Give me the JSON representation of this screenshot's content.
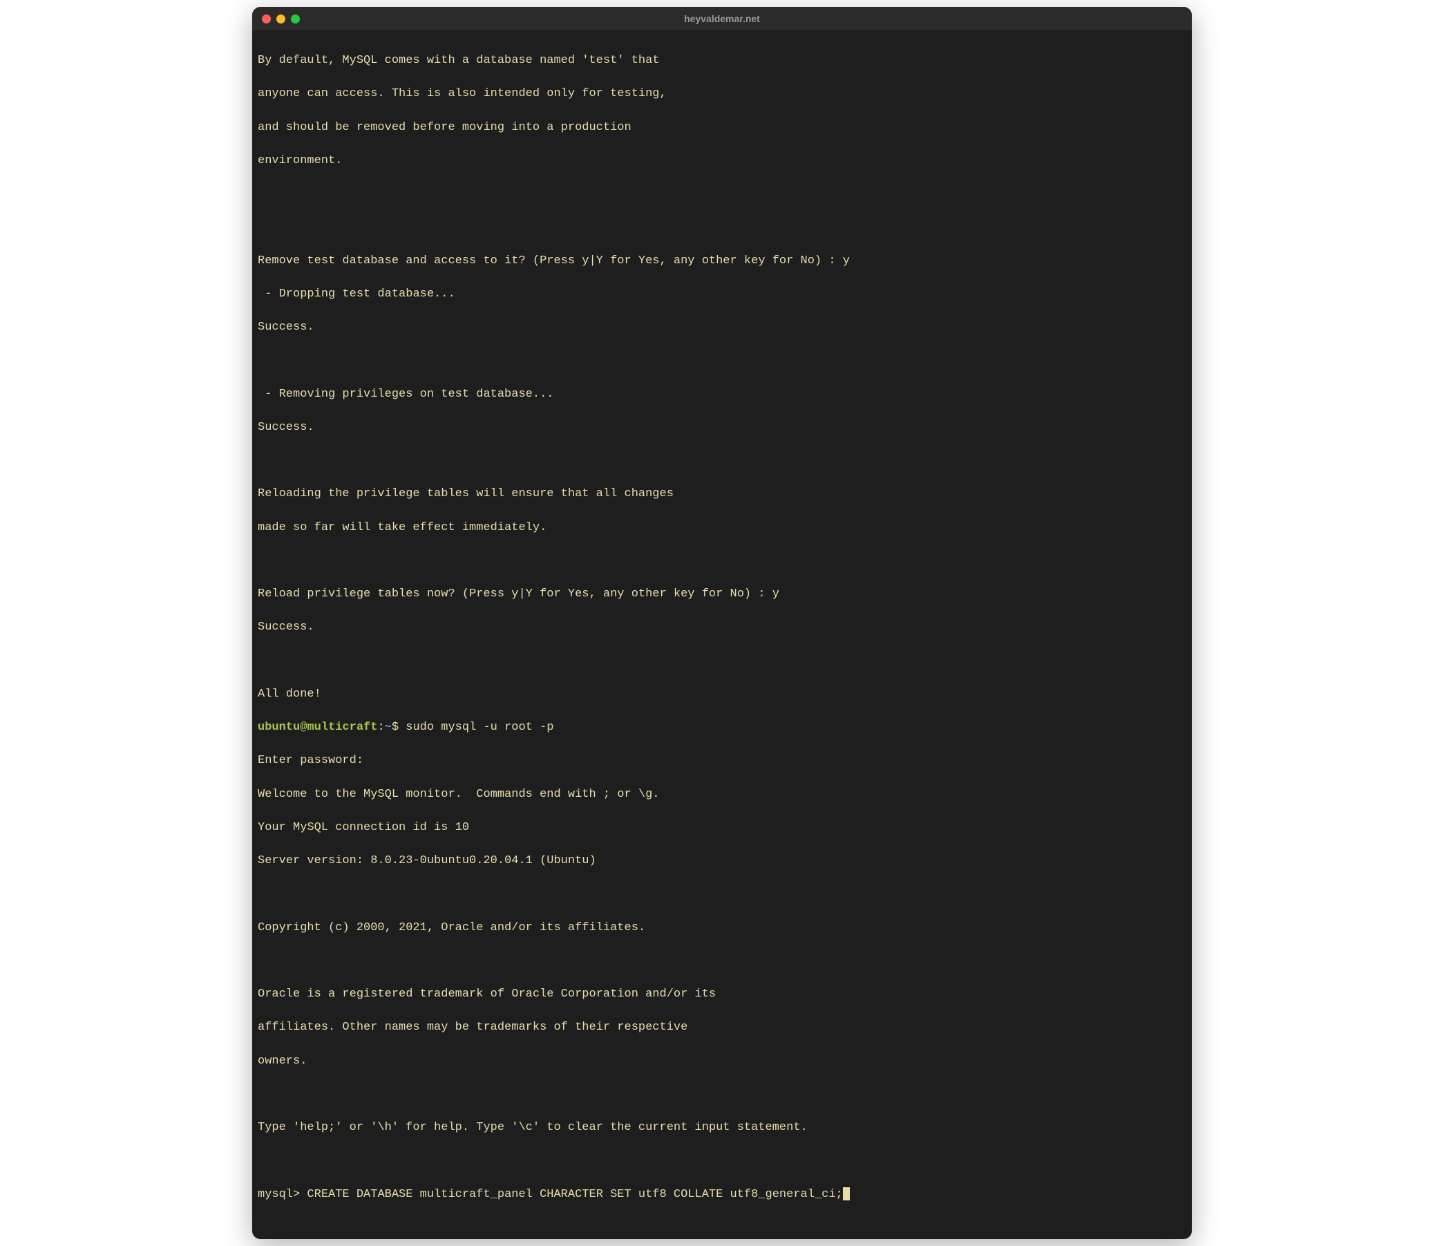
{
  "window": {
    "title": "heyvaldemar.net"
  },
  "prompt": {
    "user_host": "ubuntu@multicraft",
    "colon": ":",
    "path": "~",
    "symbol": "$ "
  },
  "mysql_prompt": "mysql> ",
  "lines": {
    "l0": "By default, MySQL comes with a database named 'test' that",
    "l1": "anyone can access. This is also intended only for testing,",
    "l2": "and should be removed before moving into a production",
    "l3": "environment.",
    "l4": "",
    "l5": "",
    "l6": "Remove test database and access to it? (Press y|Y for Yes, any other key for No) : y",
    "l7": " - Dropping test database...",
    "l8": "Success.",
    "l9": "",
    "l10": " - Removing privileges on test database...",
    "l11": "Success.",
    "l12": "",
    "l13": "Reloading the privilege tables will ensure that all changes",
    "l14": "made so far will take effect immediately.",
    "l15": "",
    "l16": "Reload privilege tables now? (Press y|Y for Yes, any other key for No) : y",
    "l17": "Success.",
    "l18": "",
    "l19": "All done!",
    "cmd1": "sudo mysql -u root -p",
    "l20": "Enter password:",
    "l21": "Welcome to the MySQL monitor.  Commands end with ; or \\g.",
    "l22": "Your MySQL connection id is 10",
    "l23": "Server version: 8.0.23-0ubuntu0.20.04.1 (Ubuntu)",
    "l24": "",
    "l25": "Copyright (c) 2000, 2021, Oracle and/or its affiliates.",
    "l26": "",
    "l27": "Oracle is a registered trademark of Oracle Corporation and/or its",
    "l28": "affiliates. Other names may be trademarks of their respective",
    "l29": "owners.",
    "l30": "",
    "l31": "Type 'help;' or '\\h' for help. Type '\\c' to clear the current input statement.",
    "l32": "",
    "cmd2": "CREATE DATABASE multicraft_panel CHARACTER SET utf8 COLLATE utf8_general_ci;"
  }
}
